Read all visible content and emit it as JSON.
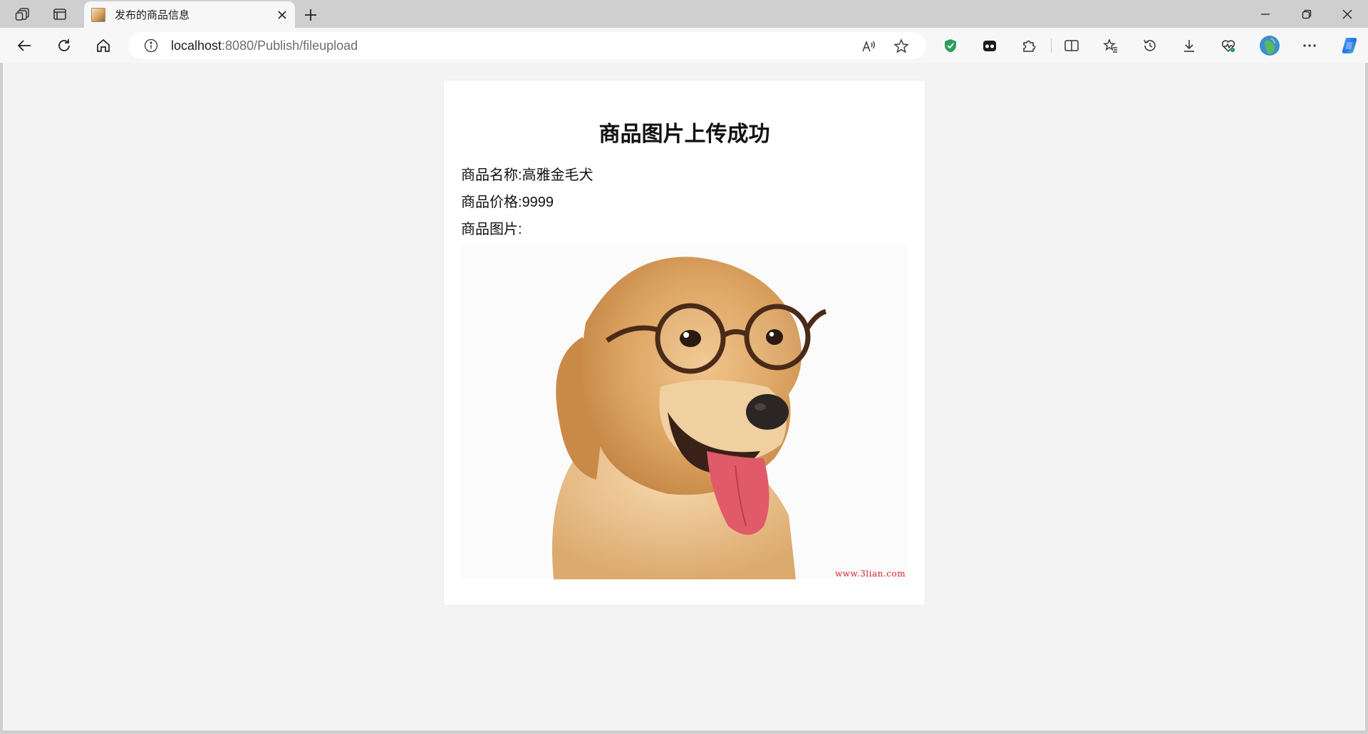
{
  "browser": {
    "tab": {
      "title": "发布的商品信息"
    },
    "address": {
      "host": "localhost",
      "rest": ":8080/Publish/fileupload"
    }
  },
  "icons": {
    "workspaces": "workspaces-icon",
    "tab_actions": "tab-actions-icon",
    "back": "back-arrow-icon",
    "refresh": "refresh-icon",
    "home": "home-icon",
    "info": "info-icon",
    "read_aloud": "read-aloud-icon",
    "favorite": "star-icon",
    "shield": "shield-icon",
    "extension": "extension-icon",
    "puzzle": "puzzle-icon",
    "split": "split-screen-icon",
    "favorites": "favorites-icon",
    "history": "history-icon",
    "download": "download-icon",
    "heart": "browser-essentials-icon",
    "profile": "profile-icon",
    "more": "more-icon",
    "copilot": "copilot-icon"
  },
  "colors": {
    "chrome": "#cfcfcf",
    "toolbar": "#f7f7f7",
    "page_bg": "#f3f3f3",
    "card_bg": "#ffffff",
    "shield_green": "#2f9e5b",
    "watermark_red": "#d2242e"
  },
  "page": {
    "heading": "商品图片上传成功",
    "name_label": "商品名称:",
    "name_value": "高雅金毛犬",
    "price_label": "商品价格:",
    "price_value": "9999",
    "image_label": "商品图片:",
    "image_watermark": "www.3lian.com"
  }
}
